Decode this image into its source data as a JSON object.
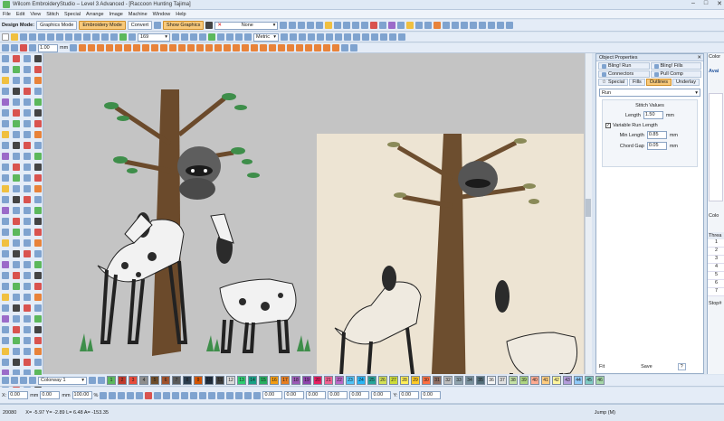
{
  "window": {
    "title": "Wilcom EmbroideryStudio – Level 3 Advanced - [Raccoon Hunting     Tajima]",
    "controls": [
      "–",
      "□",
      "✕"
    ]
  },
  "menu": {
    "items": [
      "File",
      "Edit",
      "View",
      "Stitch",
      "Special",
      "Arrange",
      "Image",
      "Machine",
      "Window",
      "Help"
    ]
  },
  "toolbar": {
    "design_mode_label": "Design Mode:",
    "graphics_mode": "Graphics Mode",
    "embroidery_mode": "Embroidery Mode",
    "convert": "Convert",
    "show_graphics": "Show Graphics",
    "none_select": "None",
    "zoom_value": "169",
    "metric": "Metric",
    "width_value": "1.00",
    "width_unit": "mm"
  },
  "object_properties": {
    "title": "Object Properties",
    "tabs_row1": [
      "Bling! Run",
      "Bling! Fills"
    ],
    "tabs_row2": [
      "Connectors",
      "Pull Comp"
    ],
    "tabs_row3": [
      "Special",
      "Fills",
      "Outlines",
      "Underlay"
    ],
    "type_select": "Run",
    "section": "Stitch Values",
    "length_label": "Length",
    "length_value": "1.50",
    "length_unit": "mm",
    "variable_run_length": "Variable Run Length",
    "min_length_label": "Min Length",
    "min_length_value": "0.85",
    "chord_gap_label": "Chord Gap",
    "chord_gap_value": "0.05",
    "fit_label": "Fit",
    "save_label": "Save",
    "help_label": "?"
  },
  "far_right": {
    "color_label": "Color",
    "avail_label": "Avai",
    "color2_label": "Colo",
    "thread_label": "Threa",
    "stop_label": "Stop#",
    "rows": [
      "1",
      "2",
      "3",
      "4",
      "5",
      "6",
      "7"
    ]
  },
  "colorway": {
    "label": "Colorway 1",
    "swatches": [
      {
        "n": "1",
        "c": "#5cb85c"
      },
      {
        "n": "2",
        "c": "#c0392b"
      },
      {
        "n": "3",
        "c": "#e74c3c"
      },
      {
        "n": "4",
        "c": "#8e8e8e"
      },
      {
        "n": "5",
        "c": "#6d4c2a"
      },
      {
        "n": "6",
        "c": "#a0522d"
      },
      {
        "n": "7",
        "c": "#5a5a5a"
      },
      {
        "n": "8",
        "c": "#2c3e50"
      },
      {
        "n": "9",
        "c": "#d35400"
      },
      {
        "n": "10",
        "c": "#1f2d3d"
      },
      {
        "n": "11",
        "c": "#3c3c3c"
      },
      {
        "n": "12",
        "c": "#dcdcdc"
      },
      {
        "n": "13",
        "c": "#2ecc71"
      },
      {
        "n": "14",
        "c": "#16a085"
      },
      {
        "n": "15",
        "c": "#27ae60"
      },
      {
        "n": "16",
        "c": "#f39c12"
      },
      {
        "n": "17",
        "c": "#e67e22"
      },
      {
        "n": "18",
        "c": "#9b59b6"
      },
      {
        "n": "19",
        "c": "#8e44ad"
      },
      {
        "n": "20",
        "c": "#e91e63"
      },
      {
        "n": "21",
        "c": "#f06292"
      },
      {
        "n": "22",
        "c": "#ba68c8"
      },
      {
        "n": "23",
        "c": "#4fc3f7"
      },
      {
        "n": "24",
        "c": "#29b6f6"
      },
      {
        "n": "25",
        "c": "#26a69a"
      },
      {
        "n": "26",
        "c": "#d4e157"
      },
      {
        "n": "27",
        "c": "#cddc39"
      },
      {
        "n": "28",
        "c": "#ffee58"
      },
      {
        "n": "29",
        "c": "#ffca28"
      },
      {
        "n": "30",
        "c": "#ff7043"
      },
      {
        "n": "31",
        "c": "#8d6e63"
      },
      {
        "n": "32",
        "c": "#bdbdbd"
      },
      {
        "n": "33",
        "c": "#90a4ae"
      },
      {
        "n": "34",
        "c": "#78909c"
      },
      {
        "n": "35",
        "c": "#546e7a"
      },
      {
        "n": "36",
        "c": "#f5f5f5"
      },
      {
        "n": "37",
        "c": "#e0e0e0"
      },
      {
        "n": "38",
        "c": "#c5e1a5"
      },
      {
        "n": "39",
        "c": "#aed581"
      },
      {
        "n": "40",
        "c": "#ffab91"
      },
      {
        "n": "41",
        "c": "#ffcc80"
      },
      {
        "n": "42",
        "c": "#fff59d"
      },
      {
        "n": "43",
        "c": "#b39ddb"
      },
      {
        "n": "44",
        "c": "#90caf9"
      },
      {
        "n": "45",
        "c": "#80cbc4"
      },
      {
        "n": "46",
        "c": "#a5d6a7"
      }
    ]
  },
  "bottombar": {
    "x_label": "X:",
    "x_val": "0.00",
    "y_label": "Y:",
    "y_val": "0.00",
    "w_val": "0.00",
    "h_val": "0.00",
    "unit": "mm",
    "pct": "%",
    "pct_val": "100.00",
    "vals": [
      "0.00",
      "0.00",
      "0.00",
      "0.00",
      "0.00",
      "0.00"
    ]
  },
  "status": {
    "stitches": "20080",
    "coords": "X= -5.97  Y= -2.89  L=  6.48  A= -153.35",
    "mode": "Jump (M)"
  },
  "colors": {
    "accent": "#f8c97a",
    "bg": "#dbe5f1",
    "canvas": "#c4c4c4"
  }
}
